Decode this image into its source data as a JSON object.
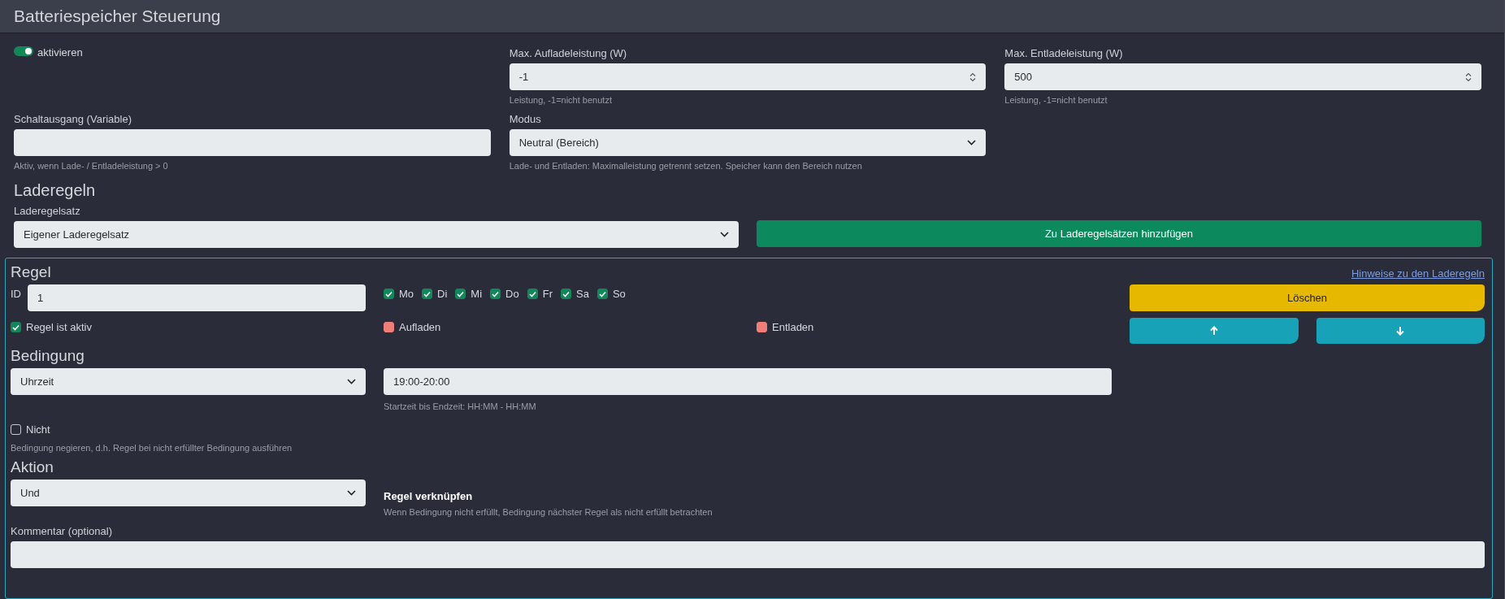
{
  "header": {
    "title": "Batteriespeicher Steuerung"
  },
  "enable": {
    "label": "aktivieren",
    "on": true
  },
  "max_charge": {
    "label": "Max. Aufladeleistung (W)",
    "value": "-1",
    "help": "Leistung, -1=nicht benutzt"
  },
  "max_discharge": {
    "label": "Max. Entladeleistung (W)",
    "value": "500",
    "help": "Leistung, -1=nicht benutzt"
  },
  "switch_output": {
    "label": "Schaltausgang (Variable)",
    "help": "Aktiv, wenn Lade- / Entladeleistung > 0"
  },
  "mode": {
    "label": "Modus",
    "value": "Neutral (Bereich)",
    "help": "Lade- und Entladen: Maximalleistung getrennt setzen. Speicher kann den Bereich nutzen"
  },
  "rules_heading": "Laderegeln",
  "ruleset": {
    "label": "Laderegelsatz",
    "value": "Eigener Laderegelsatz"
  },
  "add_button": "Zu Laderegelsätzen hinzufügen",
  "rule": {
    "heading": "Regel",
    "help_link": "Hinweise zu den Laderegeln",
    "id": {
      "label": "ID",
      "value": "1"
    },
    "days": [
      {
        "label": "Mo",
        "checked": true
      },
      {
        "label": "Di",
        "checked": true
      },
      {
        "label": "Mi",
        "checked": true
      },
      {
        "label": "Do",
        "checked": true
      },
      {
        "label": "Fr",
        "checked": true
      },
      {
        "label": "Sa",
        "checked": true
      },
      {
        "label": "So",
        "checked": true
      }
    ],
    "delete_button": "Löschen",
    "active": {
      "label": "Regel ist aktiv",
      "checked": true
    },
    "charge": {
      "label": "Aufladen",
      "checked": false,
      "invalid": true
    },
    "discharge": {
      "label": "Entladen",
      "checked": false,
      "invalid": true
    },
    "condition": {
      "heading": "Bedingung",
      "type": "Uhrzeit",
      "value": "19:00-20:00",
      "help": "Startzeit bis Endzeit: HH:MM - HH:MM"
    },
    "negate": {
      "label": "Nicht",
      "checked": false,
      "help": "Bedingung negieren, d.h. Regel bei nicht erfüllter Bedingung ausführen"
    },
    "action": {
      "heading": "Aktion",
      "value": "Und",
      "label": "Regel verknüpfen",
      "help": "Wenn Bedingung nicht erfüllt, Bedingung nächster Regel als nicht erfüllt betrachten"
    },
    "comment": {
      "label": "Kommentar (optional)"
    }
  }
}
